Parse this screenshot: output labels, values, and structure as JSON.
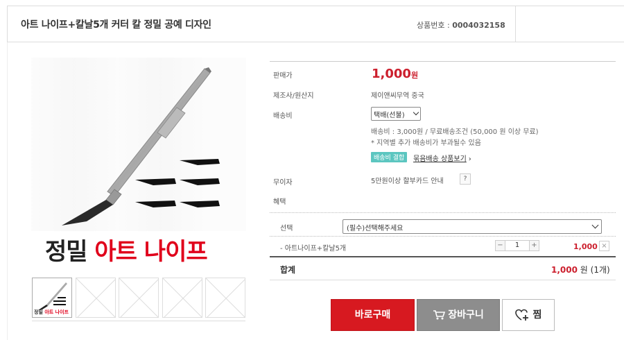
{
  "header": {
    "title": "아트 나이프+칼날5개 커터 칼 정밀 공예 디자인",
    "product_no_label": "상품번호 :",
    "product_no": "0004032158"
  },
  "image": {
    "caption_black": "정밀",
    "caption_red": "아트 나이프",
    "thumb_caption_black": "정밀",
    "thumb_caption_red": "아트 나이프"
  },
  "info": {
    "price_label": "판매가",
    "price": "1,000",
    "price_unit": "원",
    "maker_label": "제조사/원산지",
    "maker_value": "제이앤씨무역 중국",
    "ship_label": "배송비",
    "ship_select": "택배(선불)",
    "ship_note1": "배송비 : 3,000원 / 무료배송조건 (50,000 원 이상 무료)",
    "ship_note2": "* 지역별 추가 배송비가 부과될수 있음",
    "ship_badge": "배송비 결합",
    "ship_link": "묶음배송 상품보기",
    "ship_link_arrow": "›",
    "installment_label": "무이자",
    "installment_value": "5만원이상 할부카드 안내",
    "installment_help": "?",
    "benefit_label": "혜택"
  },
  "option": {
    "label": "선택",
    "select": "(필수)선택해주세요",
    "item_name": "- 아트나이프+칼날5개",
    "minus": "−",
    "qty": "1",
    "plus": "+",
    "item_price": "1,000",
    "remove": "×"
  },
  "total": {
    "label": "합계",
    "amount": "1,000",
    "unit": "원",
    "count": "(1개)"
  },
  "buttons": {
    "buy": "바로구매",
    "cart": "장바구니",
    "wish": "찜"
  },
  "colors": {
    "accent_red": "#cc1f2d",
    "buy_bg": "#d71920",
    "cart_bg": "#8d8d8d",
    "badge_bg": "#5cc6c0"
  }
}
